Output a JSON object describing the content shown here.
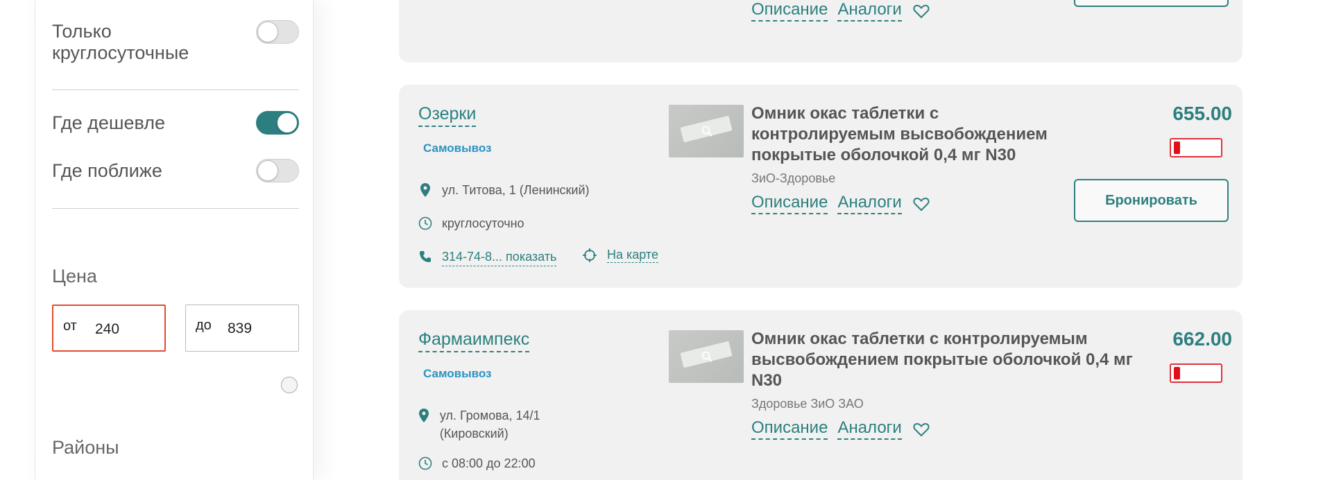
{
  "filters": {
    "only_24h_label": "Только круглосуточные",
    "cheapest_label": "Где дешевле",
    "nearest_label": "Где поближе",
    "only_24h_on": false,
    "cheapest_on": true,
    "nearest_on": false,
    "price_title": "Цена",
    "price_from_prefix": "от",
    "price_from_value": "240",
    "price_to_prefix": "до",
    "price_to_value": "839",
    "districts_title": "Районы"
  },
  "common": {
    "description_label": "Описание",
    "analogs_label": "Аналоги",
    "pickup_label": "Самовывоз",
    "reserve_label": "Бронировать",
    "map_label": "На карте"
  },
  "results": [
    {
      "pharmacy": "Озерки",
      "address": "ул. Титова, 1 (Ленинский)",
      "hours": "круглосуточно",
      "phone": "314-74-8... показать",
      "product": "Омник окас таблетки с контролируемым высвобождением покрытые оболочкой 0,4 мг N30",
      "maker": "ЗиО-Здоровье",
      "price": "655.00",
      "stock_level": 0.1
    },
    {
      "pharmacy": "Фармаимпекс",
      "address": "ул. Громова, 14/1 (Кировский)",
      "hours": "с 08:00 до 22:00",
      "product": "Омник окас таблетки с контролируемым высвобождением покрытые оболочкой 0,4 мг N30",
      "maker": "Здоровье ЗиО ЗАО",
      "price": "662.00",
      "stock_level": 0.1
    }
  ],
  "colors": {
    "accent": "#2d7f7f",
    "pickup": "#2a93c3",
    "stock_low": "#e0101a",
    "input_active": "#e14b2f"
  }
}
